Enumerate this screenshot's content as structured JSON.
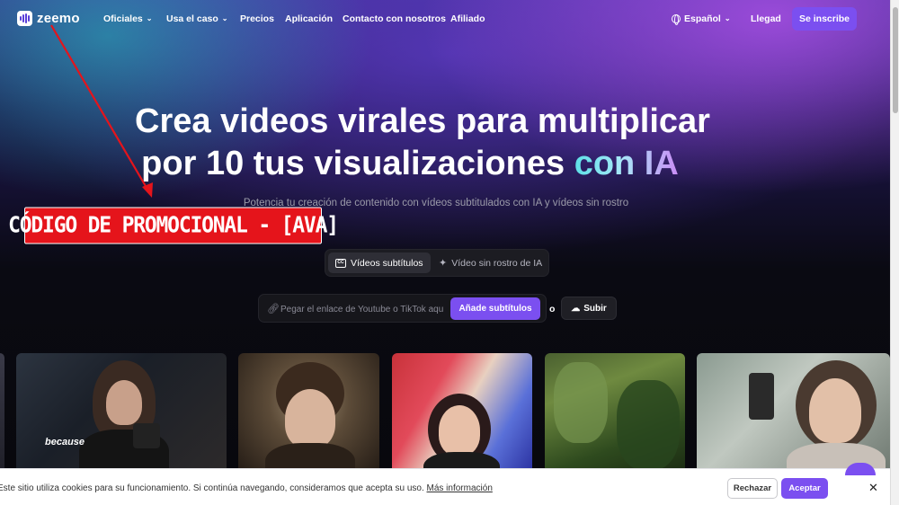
{
  "nav": {
    "logo": "zeemo",
    "items": [
      {
        "label": "Oficiales",
        "has_dropdown": true
      },
      {
        "label": "Usa el caso",
        "has_dropdown": true
      },
      {
        "label": "Precios",
        "has_dropdown": false
      },
      {
        "label": "Aplicación",
        "has_dropdown": false
      },
      {
        "label": "Contacto con nosotros",
        "has_dropdown": false
      },
      {
        "label": "Afiliado",
        "has_dropdown": false
      }
    ],
    "language": "Español",
    "login": "Llegad",
    "signup": "Se inscribe"
  },
  "hero": {
    "title_line1": "Crea videos virales para multiplicar",
    "title_line2_plain": "por 10 tus visualizaciones ",
    "title_line2_accent": "con IA",
    "subtitle": "Potencia tu creación de contenido con vídeos subtitulados con IA y vídeos sin rostro"
  },
  "promo_banner": "CÓDIGO DE PROMOCIONAL - [AVA]",
  "tabs": [
    {
      "label": "Vídeos subtítulos",
      "icon": "captions-icon",
      "active": true
    },
    {
      "label": "Vídeo sin rostro de IA",
      "icon": "sparkle-icon",
      "active": false
    }
  ],
  "input": {
    "placeholder": "Pegar el enlace de Youtube o TikTok aquí",
    "value": "",
    "add_button": "Añade subtítulos",
    "or_text": "o",
    "upload_button": "Subir"
  },
  "thumbnails": {
    "caption": "because"
  },
  "cookie": {
    "text": "Este sitio utiliza cookies para su funcionamiento. Si continúa navegando, consideramos que acepta su uso.",
    "link": "Más información",
    "reject": "Rechazar",
    "accept": "Aceptar"
  },
  "colors": {
    "brand_purple": "#7b4ff0",
    "promo_red": "#e5141b",
    "arrow_red": "#e5141b"
  }
}
